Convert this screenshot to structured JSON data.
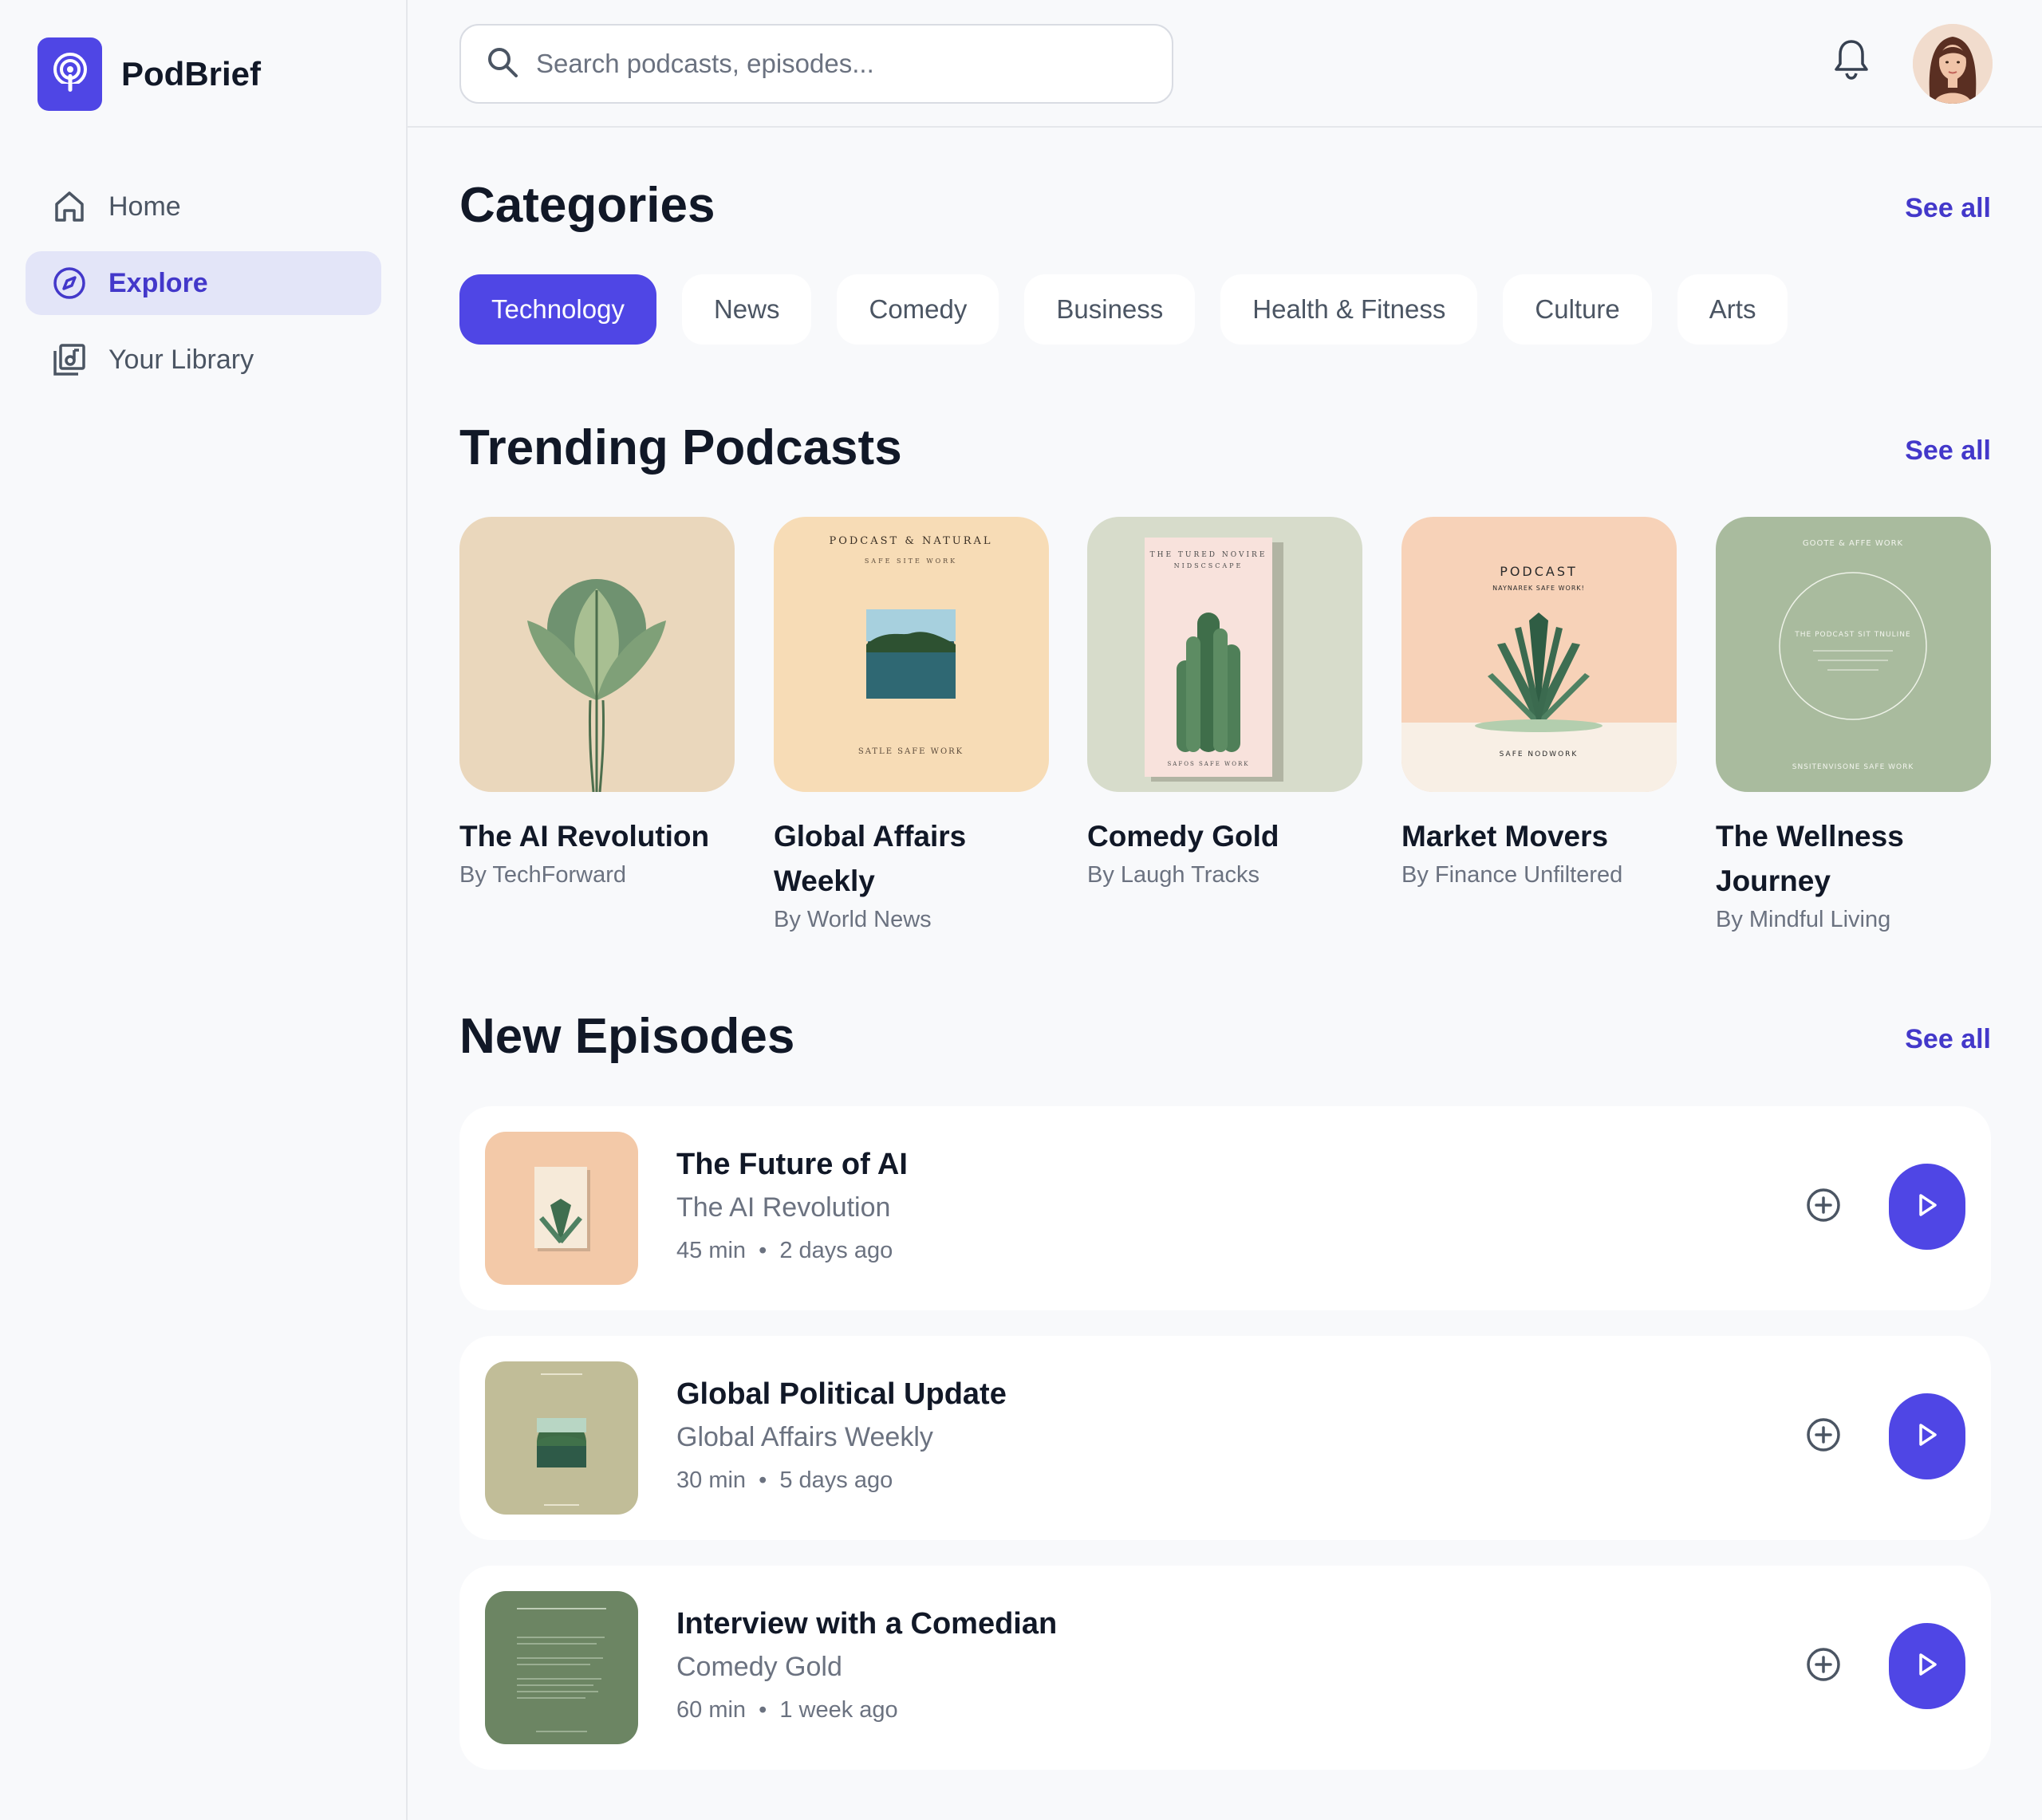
{
  "app": {
    "name": "PodBrief"
  },
  "sidebar": {
    "items": [
      {
        "label": "Home",
        "icon": "home-icon",
        "active": false
      },
      {
        "label": "Explore",
        "icon": "compass-icon",
        "active": true
      },
      {
        "label": "Your Library",
        "icon": "library-icon",
        "active": false
      }
    ]
  },
  "search": {
    "placeholder": "Search podcasts, episodes..."
  },
  "categories": {
    "title": "Categories",
    "see_all": "See all",
    "chips": [
      "Technology",
      "News",
      "Comedy",
      "Business",
      "Health & Fitness",
      "Culture",
      "Arts"
    ],
    "selected": "Technology"
  },
  "trending": {
    "title": "Trending Podcasts",
    "see_all": "See all",
    "podcasts": [
      {
        "title": "The AI Revolution",
        "author": "By TechForward",
        "cover_color": "#ead7bc"
      },
      {
        "title": "Global Affairs Weekly",
        "author": "By World News",
        "cover_color": "#f7dcb6",
        "cover_text_top": "PODCAST & NATURAL",
        "cover_text_sub": "SAFE SITE WORK",
        "cover_text_bottom": "SATLE SAFE WORK"
      },
      {
        "title": "Comedy Gold",
        "author": "By Laugh Tracks",
        "cover_color": "#d7dccb",
        "cover_text_top": "THE TURED NOVIRE",
        "cover_text_sub": "NIDSCSCAPE",
        "cover_text_bottom": "SAFOS SAFE WORK"
      },
      {
        "title": "Market Movers",
        "author": "By Finance Unfiltered",
        "cover_color": "#f7d2b8",
        "cover_text_top": "PODCAST",
        "cover_text_sub": "NAYNAREK SAFE WORK!",
        "cover_text_bottom": "SAFE NODWORK"
      },
      {
        "title": "The Wellness Journey",
        "author": "By Mindful Living",
        "cover_color": "#a9bb9e",
        "cover_text_top": "GOOTE & AFFE WORK",
        "cover_text_sub": "THE PODCAST SIT TNULINE",
        "cover_text_bottom": "SNSITENVISONE SAFE WORK"
      }
    ]
  },
  "new_episodes": {
    "title": "New Episodes",
    "see_all": "See all",
    "episodes": [
      {
        "title": "The Future of AI",
        "show": "The AI Revolution",
        "duration": "45 min",
        "age": "2 days ago",
        "thumb_color": "#f3c9a8"
      },
      {
        "title": "Global Political Update",
        "show": "Global Affairs Weekly",
        "duration": "30 min",
        "age": "5 days ago",
        "thumb_color": "#c1bd98"
      },
      {
        "title": "Interview with a Comedian",
        "show": "Comedy Gold",
        "duration": "60 min",
        "age": "1 week ago",
        "thumb_color": "#6c8563"
      }
    ],
    "separator": "•"
  },
  "colors": {
    "accent": "#4f46e5",
    "accent_text": "#4338ca",
    "background": "#f8f9fb"
  }
}
